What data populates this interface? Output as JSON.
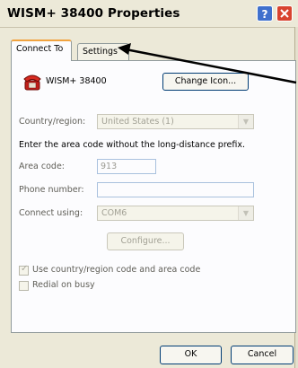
{
  "window": {
    "title": "WISM+ 38400 Properties",
    "help_glyph": "?",
    "close_glyph": "X"
  },
  "tabs": [
    {
      "label": "Connect To",
      "active": true
    },
    {
      "label": "Settings",
      "active": false
    }
  ],
  "connection": {
    "name": "WISM+ 38400",
    "change_icon_label": "Change Icon...",
    "icon": "telephone-icon"
  },
  "country": {
    "label": "Country/region:",
    "value": "United States (1)"
  },
  "instruction": "Enter the area code without the long-distance prefix.",
  "area_code": {
    "label": "Area code:",
    "value": "913"
  },
  "phone_number": {
    "label": "Phone number:",
    "value": ""
  },
  "connect_using": {
    "label": "Connect using:",
    "value": "COM6"
  },
  "configure_label": "Configure...",
  "checkboxes": [
    {
      "label": "Use country/region code and area code",
      "checked": true
    },
    {
      "label": "Redial on busy",
      "checked": false
    }
  ],
  "footer": {
    "ok_label": "OK",
    "cancel_label": "Cancel"
  },
  "annotation": {
    "arrow": "pointer-arrow-to-settings-tab",
    "color": "#000000"
  }
}
